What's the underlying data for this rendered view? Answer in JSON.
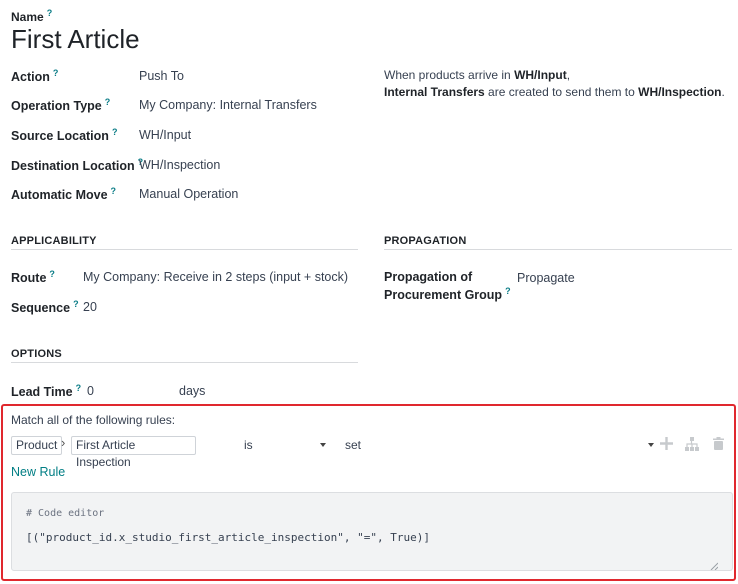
{
  "name_label": "Name",
  "help_mark": "?",
  "title": "First Article",
  "fields": {
    "action": {
      "label": "Action",
      "value": "Push To"
    },
    "operation_type": {
      "label": "Operation Type",
      "value": "My Company: Internal Transfers"
    },
    "source_location": {
      "label": "Source Location",
      "value": "WH/Input"
    },
    "destination_location": {
      "label": "Destination Location",
      "value": "WH/Inspection"
    },
    "automatic_move": {
      "label": "Automatic Move",
      "value": "Manual Operation"
    }
  },
  "explanation": {
    "line1_prefix": "When products arrive in ",
    "line1_bold": "WH/Input",
    "line1_suffix": ",",
    "line2_bold1": "Internal Transfers",
    "line2_mid": " are created to send them to ",
    "line2_bold2": "WH/Inspection",
    "line2_suffix": "."
  },
  "applicability": {
    "title": "APPLICABILITY",
    "route_label": "Route",
    "route_value": "My Company: Receive in 2 steps (input + stock)",
    "sequence_label": "Sequence",
    "sequence_value": "20"
  },
  "propagation": {
    "title": "PROPAGATION",
    "label_line1": "Propagation of",
    "label_line2": "Procurement Group",
    "value": "Propagate"
  },
  "options": {
    "title": "OPTIONS",
    "lead_time_label": "Lead Time",
    "lead_time_value": "0",
    "lead_time_unit": "days"
  },
  "domain_editor": {
    "heading": "Match all of the following rules:",
    "path": [
      "Product",
      "First Article Inspection"
    ],
    "operator": "is",
    "value": "set",
    "new_rule": "New Rule",
    "code_comment": "# Code editor",
    "code": "[(\"product_id.x_studio_first_article_inspection\", \"=\", True)]",
    "highlight_color": "#e0282e"
  }
}
